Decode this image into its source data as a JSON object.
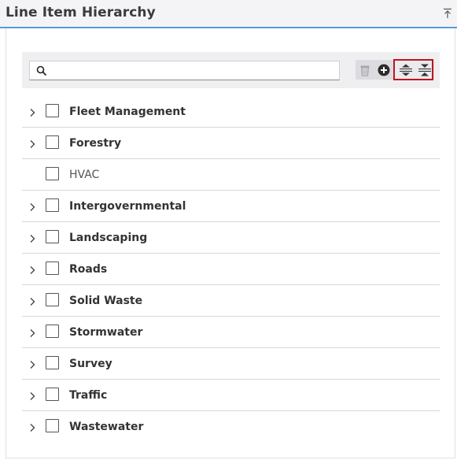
{
  "header": {
    "title": "Line Item Hierarchy"
  },
  "search": {
    "placeholder": "",
    "value": ""
  },
  "toolbar": {
    "buttons": [
      {
        "icon": "trash-icon",
        "enabled": false
      },
      {
        "icon": "add-circle-icon",
        "enabled": true
      },
      {
        "icon": "expand-all-icon",
        "enabled": true
      },
      {
        "icon": "collapse-all-icon",
        "enabled": true
      }
    ],
    "highlight_color": "#c0141e"
  },
  "tree": {
    "items": [
      {
        "label": "Fleet Management",
        "expandable": true,
        "checked": false
      },
      {
        "label": "Forestry",
        "expandable": true,
        "checked": false
      },
      {
        "label": "HVAC",
        "expandable": false,
        "checked": false
      },
      {
        "label": "Intergovernmental",
        "expandable": true,
        "checked": false
      },
      {
        "label": "Landscaping",
        "expandable": true,
        "checked": false
      },
      {
        "label": "Roads",
        "expandable": true,
        "checked": false
      },
      {
        "label": "Solid Waste",
        "expandable": true,
        "checked": false
      },
      {
        "label": "Stormwater",
        "expandable": true,
        "checked": false
      },
      {
        "label": "Survey",
        "expandable": true,
        "checked": false
      },
      {
        "label": "Traffic",
        "expandable": true,
        "checked": false
      },
      {
        "label": "Wastewater",
        "expandable": true,
        "checked": false
      }
    ]
  },
  "colors": {
    "accent": "#5b9bd5",
    "header_bg": "#f4f4f6",
    "toolbar_bg": "#efeff1"
  }
}
